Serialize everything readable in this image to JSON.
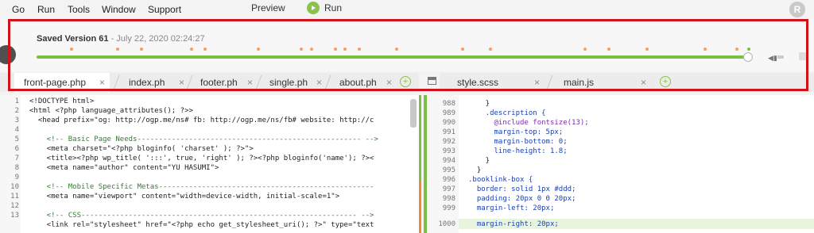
{
  "menu": [
    "Go",
    "Run",
    "Tools",
    "Window",
    "Support"
  ],
  "toolbar": {
    "preview": "Preview",
    "run": "Run"
  },
  "avatar": "R",
  "history": {
    "version": "Saved Version 61",
    "date": "- July 22, 2020 02:24:27",
    "progress": 1.0
  },
  "tabs_left": [
    {
      "label": "front-page.php",
      "active": true
    },
    {
      "label": "index.ph",
      "active": false
    },
    {
      "label": "footer.ph",
      "active": false
    },
    {
      "label": "single.ph",
      "active": false
    },
    {
      "label": "about.ph",
      "active": false
    }
  ],
  "tabs_right": [
    {
      "label": "style.scss",
      "active": false
    },
    {
      "label": "main.js",
      "active": false
    }
  ],
  "close_glyph": "×",
  "add_glyph": "+",
  "left_editor": {
    "line_numbers": [
      "1",
      "2",
      "3",
      "4",
      "5",
      "6",
      "7",
      "8",
      "9",
      "10",
      "11",
      "12",
      "13"
    ],
    "lines": [
      "<!DOCTYPE html>",
      "<html <?php language_attributes(); ?>>",
      "  <head prefix=\"og: http://ogp.me/ns# fb: http://ogp.me/ns/fb# website: http://c",
      "",
      "    <!-- Basic Page Needs---------------------------------------------------- -->",
      "    <meta charset=\"<?php bloginfo( 'charset' ); ?>\">",
      "    <title><?php wp_title( ':::', true, 'right' ); ?><?php bloginfo('name'); ?><",
      "    <meta name=\"author\" content=\"YU HASUMI\">",
      "",
      "    <!-- Mobile Specific Metas--------------------------------------------------",
      "    <meta name=\"viewport\" content=\"width=device-width, initial-scale=1\">",
      "",
      "    <!-- CSS---------------------------------------------------------------- -->",
      "    <link rel=\"stylesheet\" href=\"<?php echo get_stylesheet_uri(); ?>\" type=\"text"
    ]
  },
  "right_editor": {
    "line_numbers": [
      "988",
      "989",
      "990",
      "991",
      "992",
      "993",
      "994",
      "995",
      "996",
      "997",
      "998",
      "999",
      "1000"
    ],
    "lines": [
      "    }",
      "    .description {",
      "      @include fontsize(13);",
      "      margin-top: 5px;",
      "      margin-bottom: 0;",
      "      line-height: 1.8;",
      "    }",
      "  }",
      ".booklink-box {",
      "  border: solid 1px #ddd;",
      "  padding: 20px 0 0 20px;",
      "  margin-left: 20px;",
      "  margin-right: 20px;"
    ]
  },
  "colors": {
    "accent": "#79c143",
    "marker": "#f0a16b",
    "highlight": "#d0131a"
  }
}
